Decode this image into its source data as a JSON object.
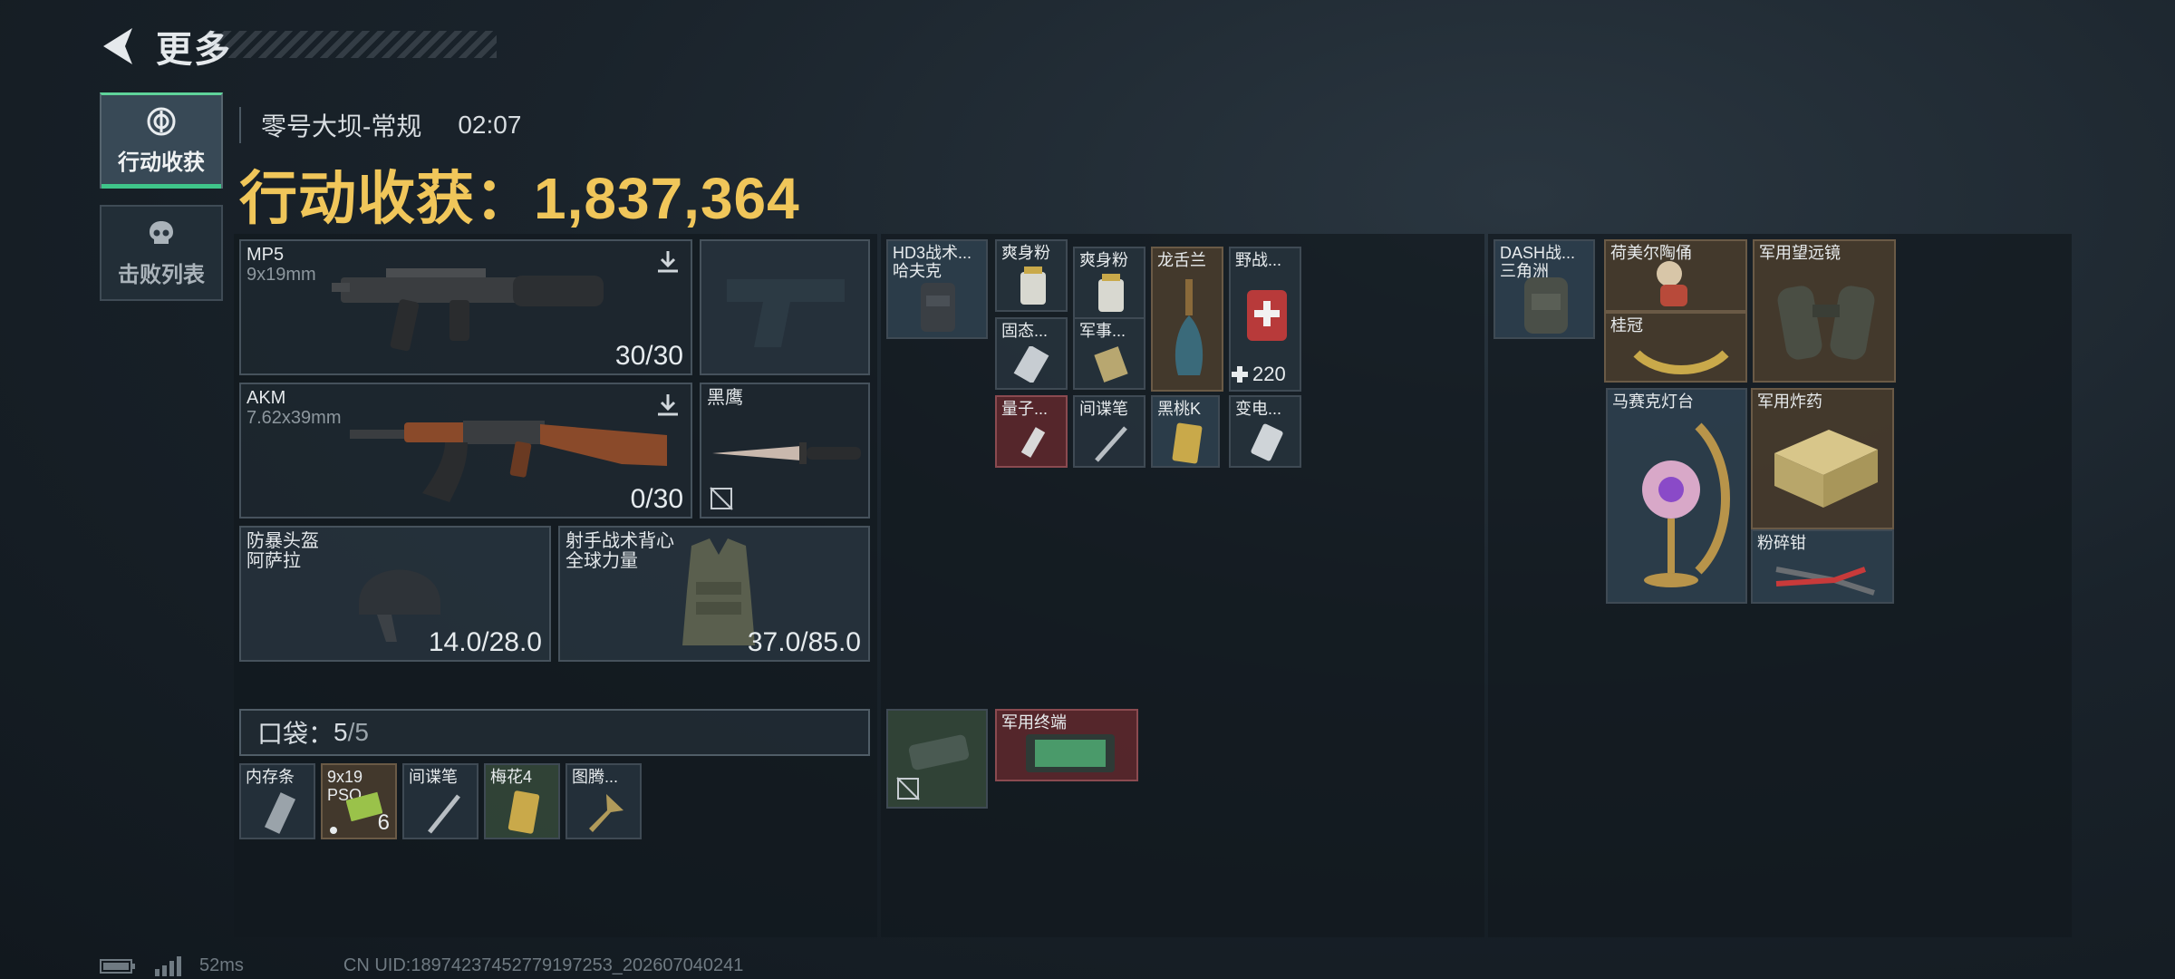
{
  "header": {
    "title": "更多"
  },
  "tabs": [
    {
      "label": "行动收获",
      "active": true
    },
    {
      "label": "击败列表",
      "active": false
    }
  ],
  "map": {
    "name": "零号大坝-常规",
    "time": "02:07"
  },
  "income": {
    "label": "行动收获：",
    "value": "1,837,364"
  },
  "loadout": {
    "primary": {
      "name": "MP5",
      "ammo": "9x19mm",
      "count": "30/30"
    },
    "secondary": {
      "name": "AKM",
      "ammo": "7.62x39mm",
      "count": "0/30"
    },
    "melee": {
      "name": "黑鹰"
    },
    "helmet": {
      "name": "防暴头盔",
      "sub": "阿萨拉",
      "durability": "14.0/28.0"
    },
    "armor": {
      "name": "射手战术背心",
      "sub": "全球力量",
      "durability": "37.0/85.0"
    }
  },
  "pocket": {
    "label": "口袋：",
    "used": "5",
    "total": "/5",
    "items": [
      {
        "name": "内存条"
      },
      {
        "name": "9x19",
        "sub": "PSO",
        "count": "6"
      },
      {
        "name": "间谍笔"
      },
      {
        "name": "梅花4"
      },
      {
        "name": "图腾..."
      }
    ]
  },
  "rig": {
    "vest": {
      "name": "HD3战术...",
      "sub": "哈夫克"
    },
    "items": [
      {
        "name": "爽身粉"
      },
      {
        "name": "爽身粉"
      },
      {
        "name": "龙舌兰"
      },
      {
        "name": "野战...",
        "count": "220"
      },
      {
        "name": "固态..."
      },
      {
        "name": "军事..."
      },
      {
        "name": "量子..."
      },
      {
        "name": "间谍笔"
      },
      {
        "name": "黑桃K"
      },
      {
        "name": "变电..."
      }
    ],
    "case": {
      "name": "军用终端"
    }
  },
  "backpack": {
    "bag": {
      "name": "DASH战...",
      "sub": "三角洲"
    },
    "items": [
      {
        "name": "荷美尔陶俑"
      },
      {
        "name": "桂冠"
      },
      {
        "name": "军用望远镜"
      },
      {
        "name": "马赛克灯台"
      },
      {
        "name": "军用炸药"
      },
      {
        "name": "粉碎钳"
      }
    ]
  },
  "footer": {
    "ping": "52ms",
    "uid": "CN UID:18974237452779197253_202607040241"
  },
  "colors": {
    "accent": "#f0c65a",
    "tab_active": "#3fc58a"
  }
}
